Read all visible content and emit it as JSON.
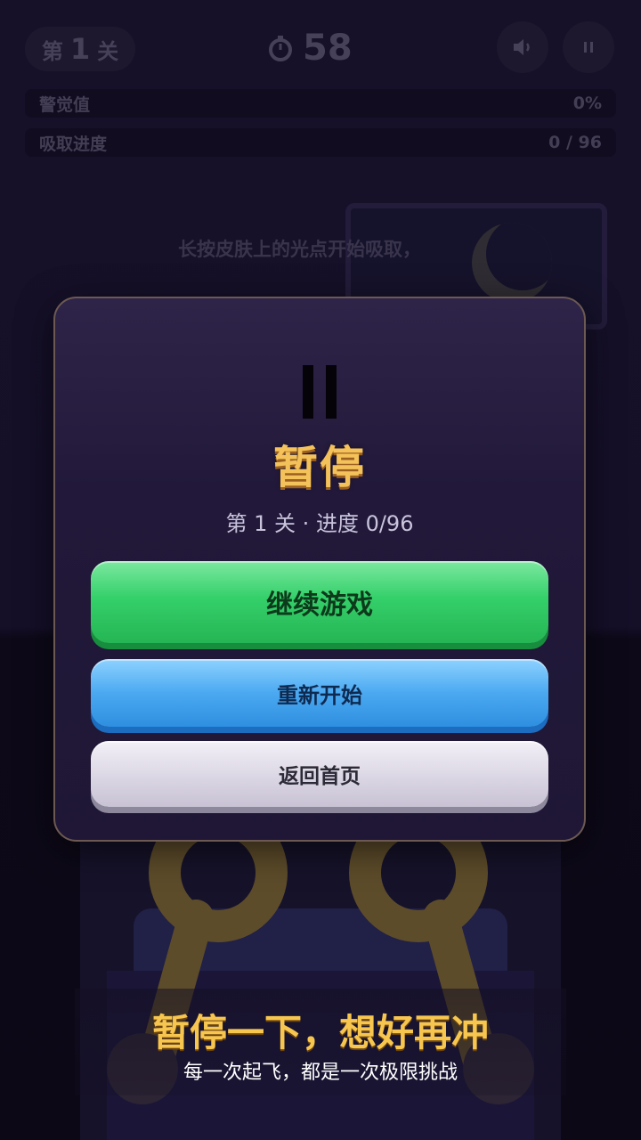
{
  "hud": {
    "level_prefix": "第",
    "level_number": "1",
    "level_suffix": "关",
    "timer_value": "58",
    "alert_label": "警觉值",
    "alert_value": "0%",
    "alert_fraction": 0,
    "progress_label": "吸取进度",
    "progress_value": "0 / 96",
    "progress_fraction": 0
  },
  "scene": {
    "hint": "长按皮肤上的光点开始吸取，"
  },
  "pause_modal": {
    "title": "暂停",
    "subtitle": "第 1 关 · 进度 0/96",
    "continue_label": "继续游戏",
    "restart_label": "重新开始",
    "home_label": "返回首页"
  },
  "caption": {
    "title": "暂停一下，想好再冲",
    "subtitle": "每一次起飞，都是一次极限挑战"
  },
  "colors": {
    "title_gold": "#f4c25a",
    "continue_green": "#34d06a",
    "restart_blue": "#4ba9f1",
    "home_grey": "#d9d4e2",
    "modal_bg": "#22193a"
  },
  "icons": {
    "timer": "stopwatch-icon",
    "sound": "speaker-icon",
    "pause": "pause-icon"
  }
}
